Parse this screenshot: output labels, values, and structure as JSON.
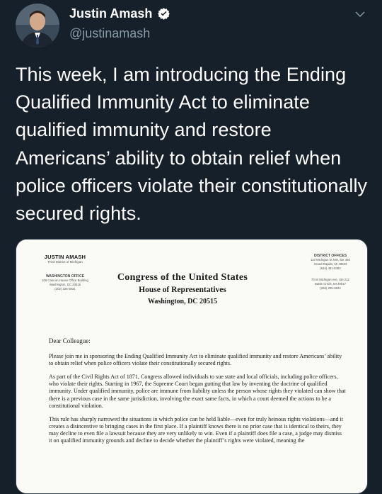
{
  "tweet": {
    "author_name": "Justin Amash",
    "handle": "@justinamash",
    "text": "This week, I am introducing the Ending Qualified Immunity Act to eliminate qualified immunity and restore Americans’ ability to obtain relief when police officers violate their constitutionally secured rights."
  },
  "colors": {
    "background": "#15202b",
    "secondary_text": "#8899a6",
    "verified_badge": "#ffffff"
  },
  "icons": {
    "verified": "verified-badge-icon",
    "menu": "chevron-down-icon"
  },
  "letter": {
    "member_name": "JUSTIN AMASH",
    "member_district": "Third District of Michigan",
    "dc_office_title": "WASHINGTON OFFICE",
    "dc_office_address": [
      "106 Cannon House Office Building",
      "Washington, DC 20515",
      "(202) 225-3831"
    ],
    "district_offices_title": "DISTRICT OFFICES",
    "district_office_1": [
      "110 Michigan St NW, Ste 460",
      "Grand Rapids, MI 49503",
      "(616) 451-8383"
    ],
    "district_office_2": [
      "70 W Michigan Ave, Ste 212",
      "Battle Creek, MI 49017",
      "(269) 205-3823"
    ],
    "letterhead_line1": "Congress of the United States",
    "letterhead_line2": "House of Representatives",
    "letterhead_line3": "Washington, DC 20515",
    "salutation": "Dear Colleague:",
    "paragraphs": [
      "Please join me in sponsoring the Ending Qualified Immunity Act to eliminate qualified immunity and restore Americans’ ability to obtain relief when police officers violate their constitutionally secured rights.",
      "As part of the Civil Rights Act of 1871, Congress allowed individuals to sue state and local officials, including police officers, who violate their rights. Starting in 1967, the Supreme Court began gutting that law by inventing the doctrine of qualified immunity. Under qualified immunity, police are immune from liability unless the person whose rights they violated can show that there is a previous case in the same jurisdiction, involving the exact same facts, in which a court deemed the actions to be a constitutional violation.",
      "This rule has sharply narrowed the situations in which police can be held liable—even for truly heinous rights violations—and it creates a disincentive to bringing cases in the first place. If a plaintiff knows there is no prior case that is identical to theirs, they may decline to even file a lawsuit because they are very unlikely to win. Even if a plaintiff does file a case, a judge may dismiss it on qualified immunity grounds and decline to decide whether the plaintiff’s rights were violated, meaning the"
    ]
  }
}
